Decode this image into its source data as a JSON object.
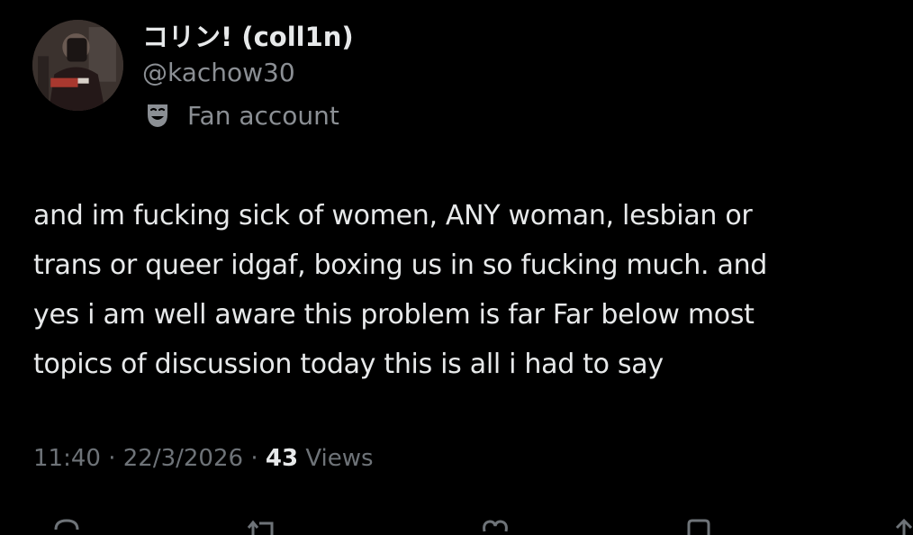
{
  "author": {
    "display_name": "コリン! (coll1n)",
    "handle": "@kachow30",
    "badge_icon": "theater-masks-icon",
    "badge_label": "Fan account"
  },
  "tweet": {
    "lines": [
      "and im fucking sick of women, ANY woman, lesbian or",
      "trans or queer idgaf, boxing us in so fucking much. and",
      "yes i am well aware this problem is far Far below most",
      "topics of discussion today this is all i had to say"
    ]
  },
  "meta": {
    "time": "11:40",
    "sep1": "·",
    "date": "22/3/2026",
    "sep2": "·",
    "views_count": "43",
    "views_label": "Views"
  },
  "actions": [
    {
      "icon": "reply-icon"
    },
    {
      "icon": "retweet-icon"
    },
    {
      "icon": "like-icon"
    },
    {
      "icon": "bookmark-icon"
    },
    {
      "icon": "share-icon"
    }
  ],
  "colors": {
    "background": "#000000",
    "text_primary": "#e7e9ea",
    "text_secondary": "#8b8f94"
  }
}
